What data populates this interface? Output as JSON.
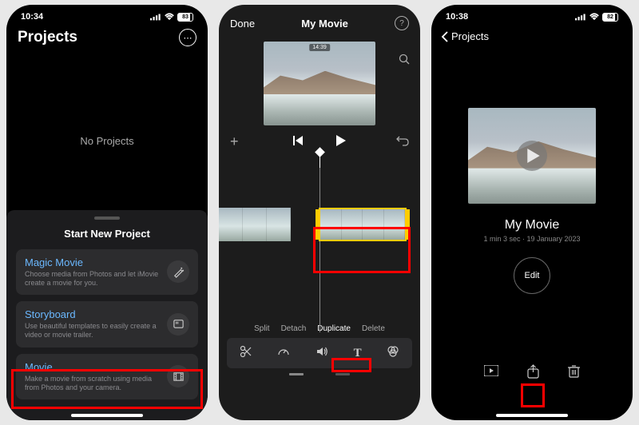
{
  "screen1": {
    "status": {
      "time": "10:34",
      "battery": "83"
    },
    "header": {
      "title": "Projects"
    },
    "empty_text": "No Projects",
    "sheet": {
      "title": "Start New Project",
      "options": [
        {
          "title": "Magic Movie",
          "desc": "Choose media from Photos and let iMovie create a movie for you.",
          "icon": "wand-icon"
        },
        {
          "title": "Storyboard",
          "desc": "Use beautiful templates to easily create a video or movie trailer.",
          "icon": "storyboard-icon"
        },
        {
          "title": "Movie",
          "desc": "Make a movie from scratch using media from Photos and your camera.",
          "icon": "film-icon"
        }
      ]
    }
  },
  "screen2": {
    "top": {
      "done": "Done",
      "title": "My Movie"
    },
    "preview_duration": "14:39",
    "actions": {
      "split": "Split",
      "detach": "Detach",
      "duplicate": "Duplicate",
      "delete": "Delete"
    }
  },
  "screen3": {
    "status": {
      "time": "10:38",
      "battery": "82"
    },
    "back": "Projects",
    "movie": {
      "title": "My Movie",
      "meta": "1 min 3 sec · 19 January 2023",
      "edit": "Edit"
    }
  },
  "colors": {
    "accent": "#6bb8ff",
    "highlight": "#ff0000",
    "selection": "#ffcc00"
  }
}
